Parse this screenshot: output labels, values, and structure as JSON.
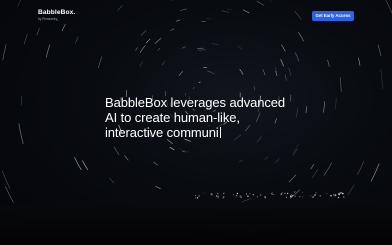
{
  "header": {
    "brand_name": "BabbleBox.",
    "brand_subtitle": "by Pleasantry_",
    "cta_label": "Get Early Access"
  },
  "hero": {
    "lines": [
      "BabbleBox leverages advanced",
      "AI to create human-like,",
      "interactive communi"
    ]
  },
  "colors": {
    "background": "#050608",
    "accent": "#2a63e6",
    "text": "#ffffff"
  }
}
